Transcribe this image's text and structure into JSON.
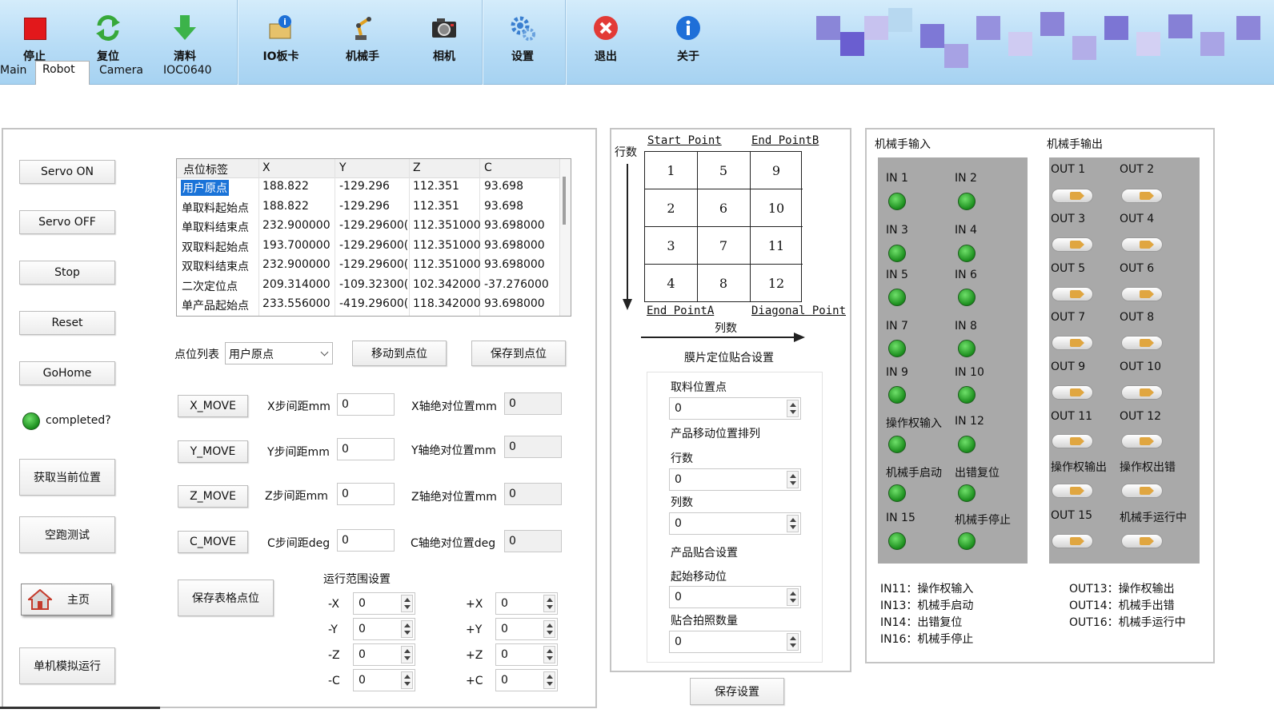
{
  "toolbar": {
    "buttons": [
      {
        "label": "停止",
        "icon": "stop-icon"
      },
      {
        "label": "复位",
        "icon": "reset-icon"
      },
      {
        "label": "清料",
        "icon": "clear-icon"
      },
      {
        "label": "IO板卡",
        "icon": "io-card-icon"
      },
      {
        "label": "机械手",
        "icon": "robot-arm-icon"
      },
      {
        "label": "相机",
        "icon": "camera-icon"
      },
      {
        "label": "设置",
        "icon": "settings-icon"
      },
      {
        "label": "退出",
        "icon": "exit-icon"
      },
      {
        "label": "关于",
        "icon": "about-icon"
      }
    ]
  },
  "tabs": [
    "Main",
    "Robot",
    "Camera",
    "IOC0640"
  ],
  "left": {
    "buttons": [
      "Servo ON",
      "Servo OFF",
      "Stop",
      "Reset",
      "GoHome"
    ],
    "completed_label": "completed?",
    "get_position": "获取当前位置",
    "dry_run": "空跑测试",
    "home": "主页",
    "single_sim": "单机模拟运行"
  },
  "points_table": {
    "columns": [
      "点位标签",
      "X",
      "Y",
      "Z",
      "C"
    ],
    "rows": [
      [
        "用户原点",
        "188.822",
        "-129.296",
        "112.351",
        "93.698"
      ],
      [
        "单取料起始点",
        "188.822",
        "-129.296",
        "112.351",
        "93.698"
      ],
      [
        "单取料结束点",
        "232.900000",
        "-129.29600(",
        "112.351000",
        "93.698000"
      ],
      [
        "双取料起始点",
        "193.700000",
        "-129.29600(",
        "112.351000",
        "93.698000"
      ],
      [
        "双取料结束点",
        "232.900000",
        "-129.29600(",
        "112.351000",
        "93.698000"
      ],
      [
        "二次定位点",
        "209.314000",
        "-109.32300(",
        "102.342000",
        "-37.276000"
      ],
      [
        "单产品起始点",
        "233.556000",
        "-419.29600(",
        "118.342000",
        "93.698000"
      ]
    ]
  },
  "point_list": {
    "label": "点位列表",
    "value": "用户原点",
    "move_btn": "移动到点位",
    "save_btn": "保存到点位"
  },
  "moves": [
    {
      "btn": "X_MOVE",
      "step_label": "X步间距mm",
      "step": "0",
      "abs_label": "X轴绝对位置mm",
      "abs": "0"
    },
    {
      "btn": "Y_MOVE",
      "step_label": "Y步间距mm",
      "step": "0",
      "abs_label": "Y轴绝对位置mm",
      "abs": "0"
    },
    {
      "btn": "Z_MOVE",
      "step_label": "Z步间距mm",
      "step": "0",
      "abs_label": "Z轴绝对位置mm",
      "abs": "0"
    },
    {
      "btn": "C_MOVE",
      "step_label": "C步间距deg",
      "step": "0",
      "abs_label": "C轴绝对位置deg",
      "abs": "0"
    }
  ],
  "save_table_btn": "保存表格点位",
  "range": {
    "title": "运行范围设置",
    "neg": [
      {
        "label": "-X",
        "value": "0"
      },
      {
        "label": "-Y",
        "value": "0"
      },
      {
        "label": "-Z",
        "value": "0"
      },
      {
        "label": "-C",
        "value": "0"
      }
    ],
    "pos": [
      {
        "label": "+X",
        "value": "0"
      },
      {
        "label": "+Y",
        "value": "0"
      },
      {
        "label": "+Z",
        "value": "0"
      },
      {
        "label": "+C",
        "value": "0"
      }
    ]
  },
  "matrix": {
    "rows_label": "行数",
    "start_point": "Start Point",
    "end_point_b": "End PointB",
    "end_point_a": "End PointA",
    "diagonal_point": "Diagonal Point",
    "cols_label": "列数",
    "cells": [
      [
        "1",
        "5",
        "9"
      ],
      [
        "2",
        "6",
        "10"
      ],
      [
        "3",
        "7",
        "11"
      ],
      [
        "4",
        "8",
        "12"
      ]
    ]
  },
  "film": {
    "title": "膜片定位贴合设置",
    "pick_label": "取料位置点",
    "pick": "0",
    "arrange_label": "产品移动位置排列",
    "rows_label": "行数",
    "rows": "0",
    "cols_label": "列数",
    "cols": "0",
    "fit_label": "产品贴合设置",
    "start_label": "起始移动位",
    "start": "0",
    "photo_label": "贴合拍照数量",
    "photo": "0",
    "save_btn": "保存设置"
  },
  "io": {
    "in_title": "机械手输入",
    "out_title": "机械手输出",
    "inputs": [
      "IN 1",
      "IN 2",
      "IN 3",
      "IN 4",
      "IN 5",
      "IN 6",
      "IN 7",
      "IN 8",
      "IN 9",
      "IN 10",
      "操作权输入",
      "IN 12",
      "机械手启动",
      "出错复位",
      "IN 15",
      "机械手停止"
    ],
    "outputs": [
      "OUT 1",
      "OUT 2",
      "OUT 3",
      "OUT 4",
      "OUT 5",
      "OUT 6",
      "OUT 7",
      "OUT 8",
      "OUT 9",
      "OUT 10",
      "OUT 11",
      "OUT 12",
      "操作权输出",
      "操作权出错",
      "OUT 15",
      "机械手运行中"
    ],
    "in_notes": [
      "IN11：操作权输入",
      "IN13：机械手启动",
      "IN14：出错复位",
      "IN16：机械手停止"
    ],
    "out_notes": [
      "OUT13：操作权输出",
      "OUT14：机械手出错",
      "OUT16：机械手运行中"
    ]
  }
}
